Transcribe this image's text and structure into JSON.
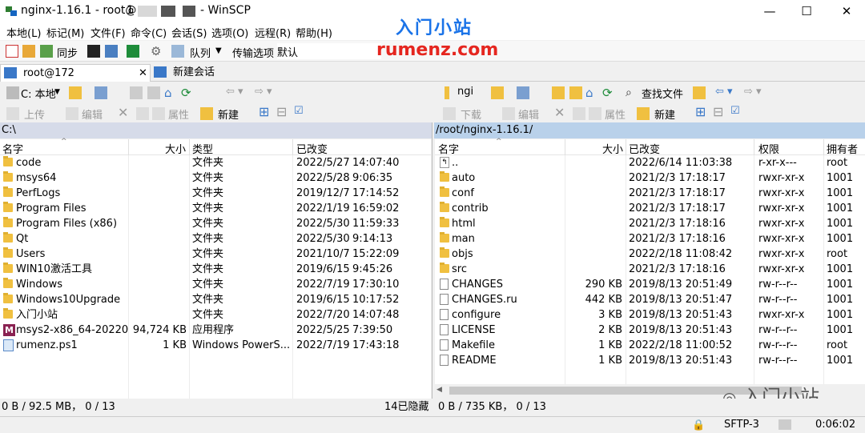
{
  "titlebar": {
    "title_prefix": "nginx-1.16.1 - root@",
    "title_suffix": "- WinSCP",
    "title_prefix_visible": "1",
    "minimize": "—",
    "maximize": "☐",
    "close": "✕"
  },
  "menu": [
    "本地(L)",
    "标记(M)",
    "文件(F)",
    "命令(C)",
    "会话(S)",
    "选项(O)",
    "远程(R)",
    "帮助(H)"
  ],
  "watermark": {
    "cn": "入门小站",
    "en": "rumenz.com",
    "wechat": "入门小站"
  },
  "toolbar": {
    "sync": "同步",
    "queue": "队列",
    "transfer_options": "传输选项",
    "preset": "默认"
  },
  "sessions": {
    "active": "root@172",
    "new": "新建会话"
  },
  "left_panel": {
    "drive": "C: 本地",
    "upload": "上传",
    "edit": "编辑",
    "properties": "属性",
    "new": "新建",
    "path": "C:\\",
    "columns": {
      "name": "名字",
      "size": "大小",
      "type": "类型",
      "changed": "已改变"
    },
    "files": [
      {
        "name": "code",
        "size": "",
        "type": "文件夹",
        "changed": "2022/5/27",
        "time": "14:07:40",
        "icon": "folder"
      },
      {
        "name": "msys64",
        "size": "",
        "type": "文件夹",
        "changed": "2022/5/28",
        "time": "9:06:35",
        "icon": "folder"
      },
      {
        "name": "PerfLogs",
        "size": "",
        "type": "文件夹",
        "changed": "2019/12/7",
        "time": "17:14:52",
        "icon": "folder"
      },
      {
        "name": "Program Files",
        "size": "",
        "type": "文件夹",
        "changed": "2022/1/19",
        "time": "16:59:02",
        "icon": "folder"
      },
      {
        "name": "Program Files (x86)",
        "size": "",
        "type": "文件夹",
        "changed": "2022/5/30",
        "time": "11:59:33",
        "icon": "folder"
      },
      {
        "name": "Qt",
        "size": "",
        "type": "文件夹",
        "changed": "2022/5/30",
        "time": "9:14:13",
        "icon": "folder"
      },
      {
        "name": "Users",
        "size": "",
        "type": "文件夹",
        "changed": "2021/10/7",
        "time": "15:22:09",
        "icon": "folder"
      },
      {
        "name": "WIN10激活工具",
        "size": "",
        "type": "文件夹",
        "changed": "2019/6/15",
        "time": "9:45:26",
        "icon": "folder"
      },
      {
        "name": "Windows",
        "size": "",
        "type": "文件夹",
        "changed": "2022/7/19",
        "time": "17:30:10",
        "icon": "folder"
      },
      {
        "name": "Windows10Upgrade",
        "size": "",
        "type": "文件夹",
        "changed": "2019/6/15",
        "time": "10:17:52",
        "icon": "folder"
      },
      {
        "name": "入门小站",
        "size": "",
        "type": "文件夹",
        "changed": "2022/7/20",
        "time": "14:07:48",
        "icon": "folder"
      },
      {
        "name": "msys2-x86_64-20220...",
        "size": "94,724 KB",
        "type": "应用程序",
        "changed": "2022/5/25",
        "time": "7:39:50",
        "icon": "exe"
      },
      {
        "name": "rumenz.ps1",
        "size": "1 KB",
        "type": "Windows PowerS...",
        "changed": "2022/7/19",
        "time": "17:43:18",
        "icon": "ps"
      }
    ],
    "status": "0 B / 92.5 MB，  0 / 13",
    "hidden": "14已隐藏"
  },
  "right_panel": {
    "dir": "ngi",
    "download": "下载",
    "edit": "编辑",
    "properties": "属性",
    "new": "新建",
    "find": "查找文件",
    "path": "/root/nginx-1.16.1/",
    "columns": {
      "name": "名字",
      "size": "大小",
      "changed": "已改变",
      "rights": "权限",
      "owner": "拥有者"
    },
    "files": [
      {
        "name": "..",
        "size": "",
        "changed": "2022/6/14 11:03:38",
        "rights": "r-xr-x---",
        "owner": "root",
        "icon": "up"
      },
      {
        "name": "auto",
        "size": "",
        "changed": "2021/2/3 17:18:17",
        "rights": "rwxr-xr-x",
        "owner": "1001",
        "icon": "folder"
      },
      {
        "name": "conf",
        "size": "",
        "changed": "2021/2/3 17:18:17",
        "rights": "rwxr-xr-x",
        "owner": "1001",
        "icon": "folder"
      },
      {
        "name": "contrib",
        "size": "",
        "changed": "2021/2/3 17:18:17",
        "rights": "rwxr-xr-x",
        "owner": "1001",
        "icon": "folder"
      },
      {
        "name": "html",
        "size": "",
        "changed": "2021/2/3 17:18:16",
        "rights": "rwxr-xr-x",
        "owner": "1001",
        "icon": "folder"
      },
      {
        "name": "man",
        "size": "",
        "changed": "2021/2/3 17:18:16",
        "rights": "rwxr-xr-x",
        "owner": "1001",
        "icon": "folder"
      },
      {
        "name": "objs",
        "size": "",
        "changed": "2022/2/18 11:08:42",
        "rights": "rwxr-xr-x",
        "owner": "root",
        "icon": "folder"
      },
      {
        "name": "src",
        "size": "",
        "changed": "2021/2/3 17:18:16",
        "rights": "rwxr-xr-x",
        "owner": "1001",
        "icon": "folder"
      },
      {
        "name": "CHANGES",
        "size": "290 KB",
        "changed": "2019/8/13 20:51:49",
        "rights": "rw-r--r--",
        "owner": "1001",
        "icon": "file"
      },
      {
        "name": "CHANGES.ru",
        "size": "442 KB",
        "changed": "2019/8/13 20:51:47",
        "rights": "rw-r--r--",
        "owner": "1001",
        "icon": "file"
      },
      {
        "name": "configure",
        "size": "3 KB",
        "changed": "2019/8/13 20:51:43",
        "rights": "rwxr-xr-x",
        "owner": "1001",
        "icon": "file"
      },
      {
        "name": "LICENSE",
        "size": "2 KB",
        "changed": "2019/8/13 20:51:43",
        "rights": "rw-r--r--",
        "owner": "1001",
        "icon": "file"
      },
      {
        "name": "Makefile",
        "size": "1 KB",
        "changed": "2022/2/18 11:00:52",
        "rights": "rw-r--r--",
        "owner": "root",
        "icon": "file"
      },
      {
        "name": "README",
        "size": "1 KB",
        "changed": "2019/8/13 20:51:43",
        "rights": "rw-r--r--",
        "owner": "1001",
        "icon": "file"
      }
    ],
    "status": "0 B / 735 KB，  0 / 13"
  },
  "bottom": {
    "protocol": "SFTP-3",
    "elapsed": "0:06:02"
  },
  "colors": {
    "path_active": "#b9d1ea",
    "path_inactive": "#d6dbe9",
    "accent": "#1a73e8",
    "brand_red": "#e5261f"
  }
}
